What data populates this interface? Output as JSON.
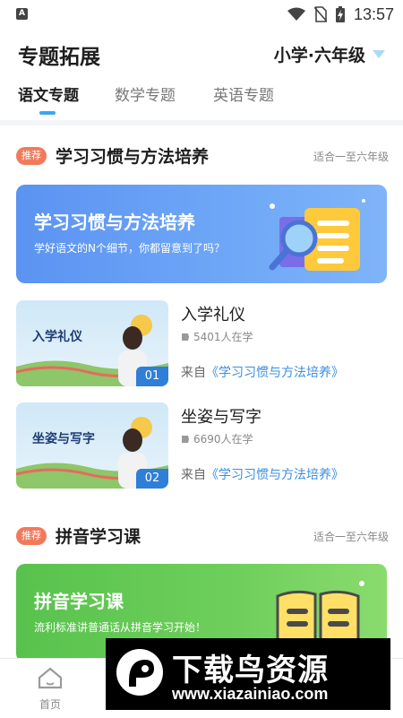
{
  "status_bar": {
    "time": "13:57",
    "notif_letter": "A"
  },
  "header": {
    "title": "专题拓展",
    "grade": "小学·六年级"
  },
  "tabs": [
    "语文专题",
    "数学专题",
    "英语专题"
  ],
  "sections": [
    {
      "badge": "推荐",
      "title": "学习习惯与方法培养",
      "meta": "适合一至六年级",
      "banner": {
        "title": "学习习惯与方法培养",
        "subtitle": "学好语文的N个细节，你都留意到了吗？"
      }
    },
    {
      "badge": "推荐",
      "title": "拼音学习课",
      "meta": "适合一至六年级",
      "banner": {
        "title": "拼音学习课",
        "subtitle": "流利标准讲普通话从拼音学习开始！"
      }
    }
  ],
  "courses": [
    {
      "thumb_label": "入学礼仪",
      "num": "01",
      "title": "入学礼仪",
      "count": "5401人在学",
      "from_prefix": "来自",
      "from_link": "《学习习惯与方法培养》"
    },
    {
      "thumb_label": "坐姿与写字",
      "num": "02",
      "title": "坐姿与写字",
      "count": "6690人在学",
      "from_prefix": "来自",
      "from_link": "《学习习惯与方法培养》"
    }
  ],
  "bottom_nav": {
    "home_label": "首页"
  },
  "watermark": {
    "name": "下载鸟资源",
    "url": "www.xiazainiao.com"
  },
  "colors": {
    "accent": "#3aa7f0",
    "badge": "#f07a5c",
    "banner_blue": "#5b93f2",
    "banner_green": "#58c24d",
    "link": "#3a8fe0"
  }
}
